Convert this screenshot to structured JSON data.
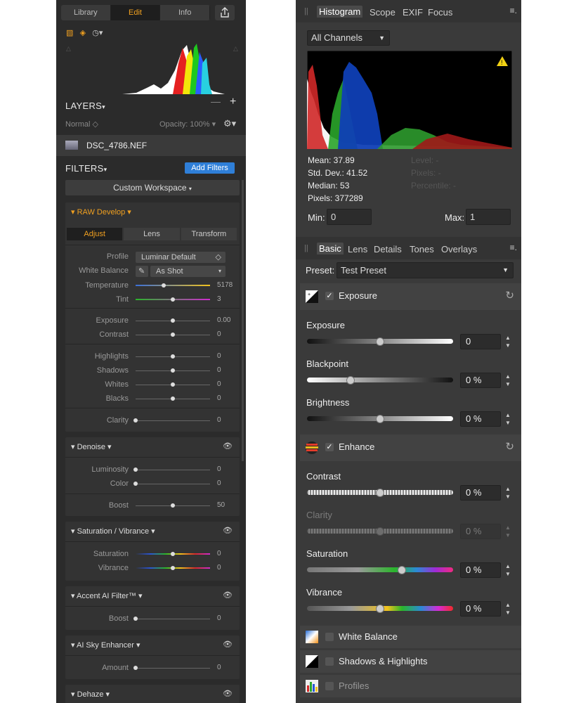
{
  "left_panel": {
    "top_tabs": [
      "Library",
      "Edit",
      "Info"
    ],
    "active_top_tab": "Edit",
    "layers": {
      "title": "LAYERS",
      "blend_mode": "Normal",
      "opacity_label": "Opacity: 100%",
      "filename": "DSC_4786.NEF"
    },
    "filters": {
      "title": "FILTERS",
      "add_button": "Add Filters",
      "workspace": "Custom Workspace"
    },
    "raw_develop": {
      "title": "RAW Develop",
      "tabs": [
        "Adjust",
        "Lens",
        "Transform"
      ],
      "profile_label": "Profile",
      "profile_value": "Luminar Default",
      "wb_label": "White Balance",
      "wb_value": "As Shot",
      "sliders": [
        {
          "label": "Temperature",
          "value": "5178",
          "pos": 0.38
        },
        {
          "label": "Tint",
          "value": "3",
          "pos": 0.5
        },
        {
          "label": "Exposure",
          "value": "0.00",
          "pos": 0.5
        },
        {
          "label": "Contrast",
          "value": "0",
          "pos": 0.5
        },
        {
          "label": "Highlights",
          "value": "0",
          "pos": 0.5
        },
        {
          "label": "Shadows",
          "value": "0",
          "pos": 0.5
        },
        {
          "label": "Whites",
          "value": "0",
          "pos": 0.5
        },
        {
          "label": "Blacks",
          "value": "0",
          "pos": 0.5
        },
        {
          "label": "Clarity",
          "value": "0",
          "pos": 0.0
        }
      ]
    },
    "denoise": {
      "title": "Denoise",
      "sliders": [
        {
          "label": "Luminosity",
          "value": "0",
          "pos": 0.0
        },
        {
          "label": "Color",
          "value": "0",
          "pos": 0.0
        },
        {
          "label": "Boost",
          "value": "50",
          "pos": 0.5
        }
      ]
    },
    "saturation_vibrance": {
      "title": "Saturation / Vibrance",
      "sliders": [
        {
          "label": "Saturation",
          "value": "0",
          "pos": 0.5
        },
        {
          "label": "Vibrance",
          "value": "0",
          "pos": 0.5
        }
      ]
    },
    "accent_ai": {
      "title": "Accent AI Filter™",
      "sliders": [
        {
          "label": "Boost",
          "value": "0",
          "pos": 0.0
        }
      ]
    },
    "ai_sky": {
      "title": "AI Sky Enhancer",
      "sliders": [
        {
          "label": "Amount",
          "value": "0",
          "pos": 0.0
        }
      ]
    },
    "dehaze": {
      "title": "Dehaze"
    }
  },
  "right_panel": {
    "top_tabs": [
      "Histogram",
      "Scope",
      "EXIF",
      "Focus"
    ],
    "active_top_tab": "Histogram",
    "channels": "All Channels",
    "stats": {
      "mean": "Mean: 37.89",
      "std": "Std. Dev.: 41.52",
      "median": "Median: 53",
      "pixels": "Pixels: 377289",
      "level": "Level: -",
      "pixels2": "Pixels: -",
      "percentile": "Percentile: -"
    },
    "min_label": "Min:",
    "min_value": "0",
    "max_label": "Max:",
    "max_value": "1",
    "basic_tabs": [
      "Basic",
      "Lens",
      "Details",
      "Tones",
      "Overlays"
    ],
    "active_basic_tab": "Basic",
    "preset_label": "Preset:",
    "preset_value": "Test Preset",
    "exposure_section": {
      "title": "Exposure",
      "controls": [
        {
          "label": "Exposure",
          "value": "0",
          "pos": 0.5
        },
        {
          "label": "Blackpoint",
          "value": "0 %",
          "pos": 0.3
        },
        {
          "label": "Brightness",
          "value": "0 %",
          "pos": 0.5
        }
      ]
    },
    "enhance_section": {
      "title": "Enhance",
      "controls": [
        {
          "label": "Contrast",
          "value": "0 %",
          "pos": 0.5
        },
        {
          "label": "Clarity",
          "value": "0 %",
          "pos": 0.5
        },
        {
          "label": "Saturation",
          "value": "0 %",
          "pos": 0.65
        },
        {
          "label": "Vibrance",
          "value": "0 %",
          "pos": 0.5
        }
      ]
    },
    "white_balance": "White Balance",
    "shadows_highlights": "Shadows & Highlights",
    "profiles": "Profiles"
  }
}
